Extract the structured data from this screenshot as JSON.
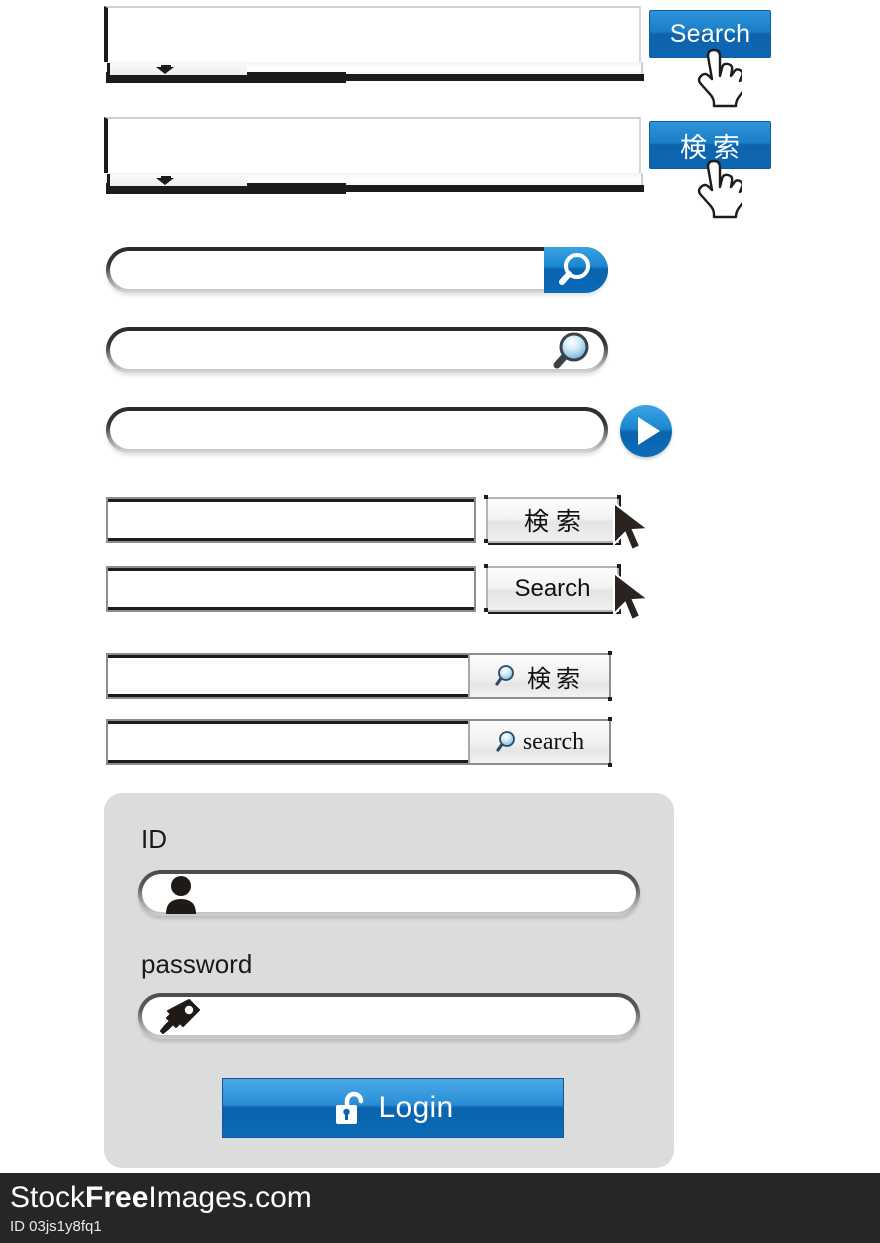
{
  "meta": {
    "accent_blue": "#0e6cb6",
    "panel_gray": "#dcdcdc",
    "footer_bg": "#262626"
  },
  "perspective_bars": [
    {
      "id": "bar-search-en",
      "input_value": "",
      "button_label": "Search",
      "button_lang": "en",
      "cursor": "hand-cursor"
    },
    {
      "id": "bar-search-jp",
      "input_value": "",
      "button_label": "検索",
      "button_lang": "jp",
      "cursor": "hand-cursor"
    }
  ],
  "pill_bars": [
    {
      "id": "pill-blue-magnifier",
      "input_value": "",
      "input_placeholder": "",
      "icon": "magnifier-icon",
      "icon_style": "blue-cap"
    },
    {
      "id": "pill-glass-magnifier",
      "input_value": "",
      "input_placeholder": "",
      "icon": "magnifier-icon",
      "icon_style": "glass"
    },
    {
      "id": "pill-play-button",
      "input_value": "",
      "input_placeholder": "",
      "icon": "play-arrow-icon",
      "icon_style": "circle"
    }
  ],
  "square_bars": [
    {
      "id": "square-jp",
      "input_value": "",
      "button_label": "検索",
      "button_lang": "jp",
      "cursor": "arrow-cursor"
    },
    {
      "id": "square-en",
      "input_value": "",
      "button_label": "Search",
      "button_lang": "en",
      "cursor": "arrow-cursor"
    }
  ],
  "attached_bars": [
    {
      "id": "attached-jp",
      "input_value": "",
      "button_label": "検索",
      "button_lang": "jp",
      "icon": "magnifier-icon"
    },
    {
      "id": "attached-en",
      "input_value": "",
      "button_label": "search",
      "button_lang": "en",
      "icon": "magnifier-icon"
    }
  ],
  "login": {
    "id_label": "ID",
    "id_value": "",
    "id_icon": "user-icon",
    "password_label": "password",
    "password_value": "",
    "password_icon": "key-icon",
    "submit_label": "Login",
    "submit_icon": "open-padlock-icon"
  },
  "footer": {
    "brand_prefix": "Stock",
    "brand_bold": "Free",
    "brand_suffix": "Images.com",
    "image_id": "ID 03js1y8fq1"
  }
}
